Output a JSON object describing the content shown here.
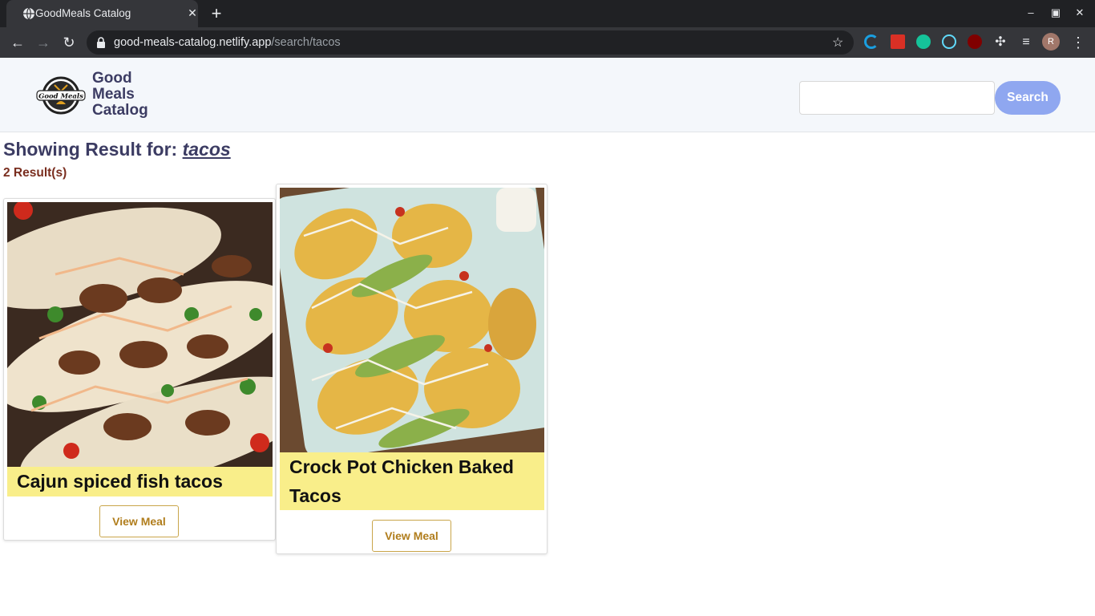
{
  "browser": {
    "tab_title": "GoodMeals Catalog",
    "url_host": "good-meals-catalog.netlify.app",
    "url_path": "/search/tacos",
    "profile_initial": "R"
  },
  "header": {
    "brand_line1": "Good",
    "brand_line2": "Meals",
    "brand_line3": "Catalog",
    "logo_text": "Good Meals",
    "search_value": "",
    "search_button": "Search"
  },
  "results": {
    "heading_prefix": "Showing Result for: ",
    "query": "tacos",
    "count_text": "2 Result(s)",
    "items": [
      {
        "title": "Cajun spiced fish tacos",
        "button": "View Meal"
      },
      {
        "title_line1": "Crock Pot Chicken Baked",
        "title_line2": "Tacos",
        "button": "View Meal"
      }
    ]
  },
  "colors": {
    "accent": "#8fa7f0",
    "title_band": "#f9ee8a",
    "heading": "#3c3c63",
    "count": "#7a2e1f"
  }
}
